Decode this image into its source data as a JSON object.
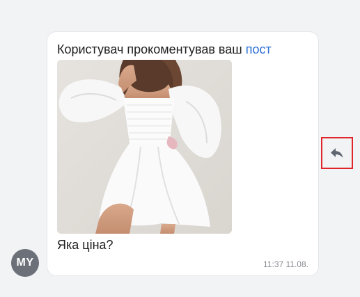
{
  "message": {
    "headline_text": "Користувач прокоментував ваш",
    "headline_link": "пост",
    "comment": "Яка ціна?",
    "timestamp": "11:37 11.08.",
    "image_alt": "white-dress-photo"
  },
  "avatar": {
    "initials": "MY",
    "color": "#6b7079"
  },
  "actions": {
    "reply_icon": "reply-arrow-icon",
    "highlight_color": "#e0262b"
  },
  "colors": {
    "link": "#2a6fd6",
    "background": "#f2f3f5"
  }
}
